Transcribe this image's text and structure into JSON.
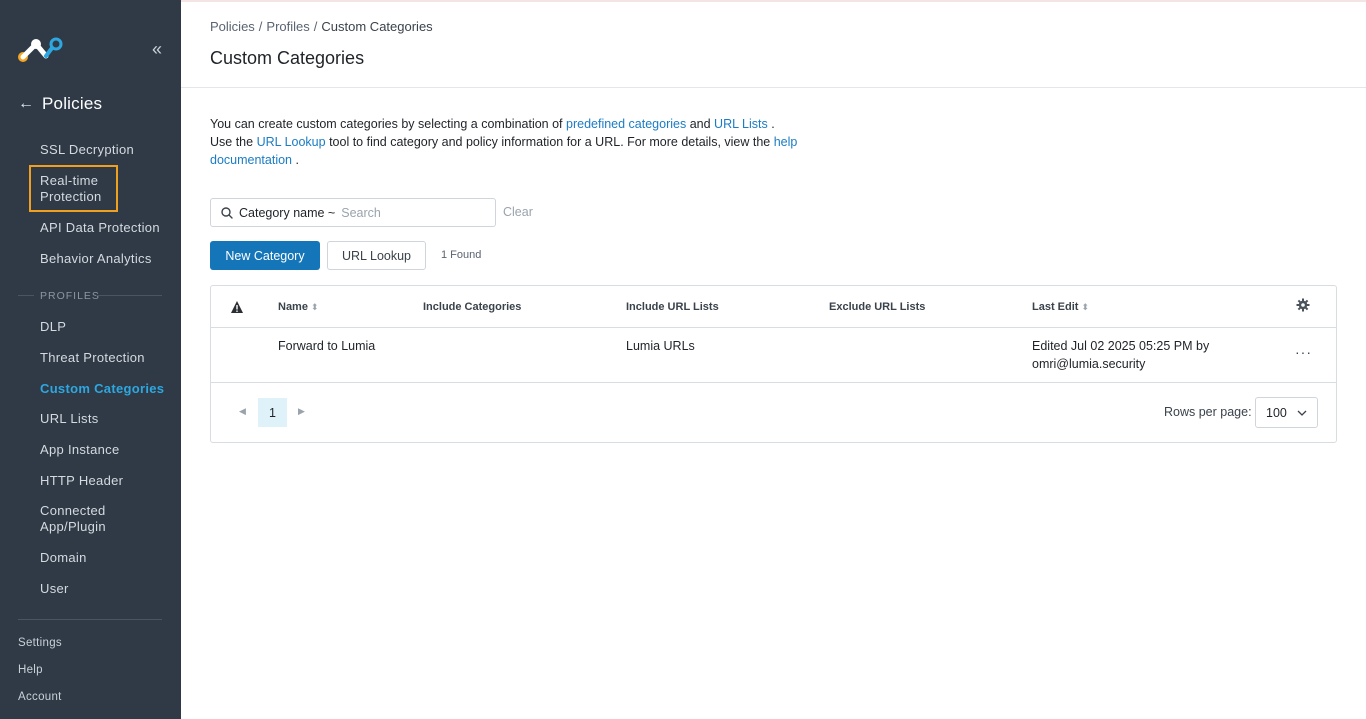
{
  "sidebar": {
    "back_title": "Policies",
    "items": [
      {
        "label": "SSL Decryption"
      },
      {
        "label": "Real-time Protection"
      },
      {
        "label": "API Data Protection"
      },
      {
        "label": "Behavior Analytics"
      }
    ],
    "section_label": "PROFILES",
    "profile_items": [
      {
        "label": "DLP"
      },
      {
        "label": "Threat Protection"
      },
      {
        "label": "Custom Categories"
      },
      {
        "label": "URL Lists"
      },
      {
        "label": "App Instance"
      },
      {
        "label": "HTTP Header"
      },
      {
        "label": "Connected App/Plugin"
      },
      {
        "label": "Domain"
      },
      {
        "label": "User"
      }
    ],
    "footer": {
      "settings": "Settings",
      "help": "Help",
      "account": "Account"
    }
  },
  "header": {
    "breadcrumb": [
      "Policies",
      "Profiles",
      "Custom Categories"
    ],
    "breadcrumb_sep": "/",
    "title": "Custom Categories"
  },
  "description": {
    "t1": "You can create custom categories by selecting a combination of ",
    "link_predefined": "predefined categories",
    "t2": " and ",
    "link_url_lists": "URL Lists",
    "t3": " . Use the ",
    "link_url_lookup": "URL Lookup",
    "t4": " tool to find category and policy information for a URL. For more details, view the ",
    "link_help": "help documentation",
    "t5": " ."
  },
  "search": {
    "filter_label": "Category name ~",
    "placeholder": "Search",
    "clear_label": "Clear"
  },
  "actions": {
    "new_category": "New Category",
    "url_lookup": "URL Lookup",
    "found": "1 Found"
  },
  "table": {
    "columns": {
      "name": "Name",
      "include_categories": "Include Categories",
      "include_url_lists": "Include URL Lists",
      "exclude_url_lists": "Exclude URL Lists",
      "last_edit": "Last Edit"
    },
    "rows": [
      {
        "name": "Forward to Lumia",
        "include_categories": "",
        "include_url_lists": "Lumia URLs",
        "exclude_url_lists": "",
        "last_edit_line1": "Edited Jul 02 2025 05:25 PM by",
        "last_edit_line2": "omri@lumia.security",
        "actions": "···"
      }
    ]
  },
  "pagination": {
    "current_page": "1",
    "rows_per_page_label": "Rows per page:",
    "rows_per_page_value": "100"
  },
  "colors": {
    "sidebar_bg": "#2f3a46",
    "accent": "#1475b8",
    "active_nav": "#2ea7e0",
    "highlight": "#f0a020",
    "logo_orange": "#f5a623",
    "logo_blue": "#2ea7e0"
  },
  "icons": [
    "logo-icon",
    "collapse-icon",
    "back-arrow-icon",
    "search-icon",
    "warning-icon",
    "sort-icon",
    "gear-icon",
    "more-icon",
    "chevron-left-icon",
    "chevron-right-icon",
    "chevron-down-icon"
  ]
}
